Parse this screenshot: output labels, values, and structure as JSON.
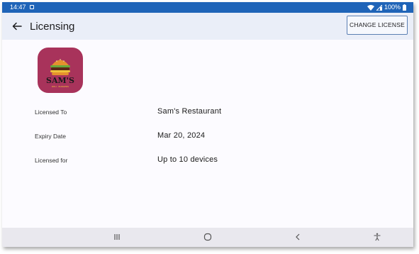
{
  "status_bar": {
    "time": "14:47",
    "battery": "100%",
    "icons": [
      "notification-icon",
      "wifi-icon",
      "signal-icon",
      "battery-icon"
    ]
  },
  "app_bar": {
    "back_icon": "arrow-left-icon",
    "title": "Licensing",
    "change_license_label": "CHANGE LICENSE"
  },
  "logo": {
    "text": "SAM'S",
    "subtext": "DELI · BURGERS"
  },
  "license_info": {
    "licensed_to_label": "Licensed To",
    "licensed_to_value": "Sam's Restaurant",
    "expiry_label": "Expiry Date",
    "expiry_value": "Mar 20, 2024",
    "licensed_for_label": "Licensed for",
    "licensed_for_value": "Up to 10 devices"
  },
  "nav_bar": {
    "icons": [
      "recent-apps-icon",
      "home-icon",
      "back-icon",
      "accessibility-icon"
    ]
  },
  "colors": {
    "status_bar": "#1f64b8",
    "app_bar": "#eaeef8",
    "logo_background": "#a8335b",
    "button_border": "#5b7fb3"
  }
}
